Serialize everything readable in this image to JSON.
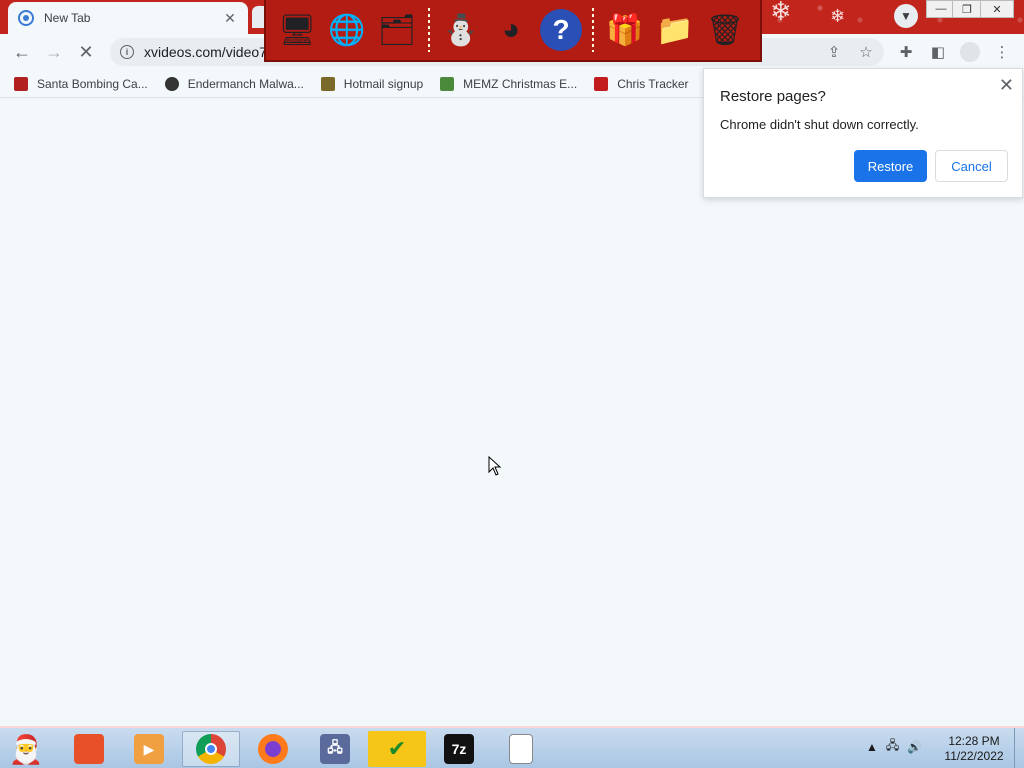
{
  "tab": {
    "title": "New Tab",
    "close": "✕"
  },
  "toolbar": {
    "url": "xvideos.com/video7"
  },
  "bookmarks": [
    {
      "label": "Santa Bombing Ca...",
      "color": "#b32020"
    },
    {
      "label": "Endermanch Malwa...",
      "color": "#333333"
    },
    {
      "label": "Hotmail signup",
      "color": "#7a6a2a"
    },
    {
      "label": "MEMZ Christmas E...",
      "color": "#4a8a3a"
    },
    {
      "label": "Chris Tracker",
      "color": "#c21c1c"
    }
  ],
  "restore": {
    "title": "Restore pages?",
    "message": "Chrome didn't shut down correctly.",
    "restore_label": "Restore",
    "cancel_label": "Cancel"
  },
  "clock": {
    "time": "12:28 PM",
    "date": "11/22/2022"
  },
  "colors": {
    "accent": "#1a73e8",
    "titlebar": "#c2251c",
    "page_bg": "#f3f8fb"
  }
}
